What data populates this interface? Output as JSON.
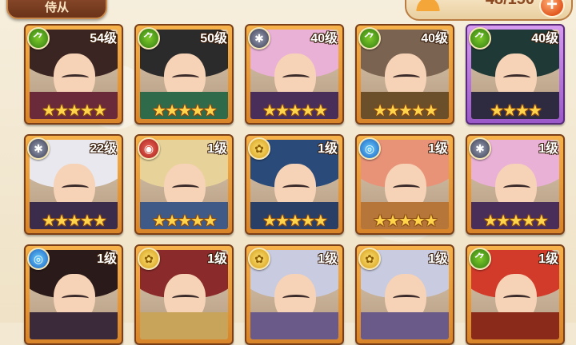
{
  "header": {
    "tab_label": "侍从",
    "capacity_text": "48/150",
    "add_label": "+"
  },
  "cards": [
    {
      "level": "54级",
      "stars": "★★★★★",
      "faction": "green",
      "theme": "orange",
      "hair": "#3a2522",
      "cloth": "#6a2a3a"
    },
    {
      "level": "50级",
      "stars": "★★★★★",
      "faction": "green",
      "theme": "orange",
      "hair": "#2b2b2b",
      "cloth": "#2f6a4b"
    },
    {
      "level": "40级",
      "stars": "★★★★★",
      "faction": "dark",
      "theme": "orange",
      "hair": "#e9b1d6",
      "cloth": "#4a2e5a"
    },
    {
      "level": "40级",
      "stars": "★★★★★",
      "faction": "green",
      "theme": "orange",
      "hair": "#7a6350",
      "cloth": "#6b4f2a"
    },
    {
      "level": "40级",
      "stars": "★★★★",
      "faction": "green",
      "theme": "purple",
      "hair": "#1f3a36",
      "cloth": "#2e2a3f"
    },
    {
      "level": "22级",
      "stars": "★★★★★",
      "faction": "dark",
      "theme": "orange",
      "hair": "#e8e8ee",
      "cloth": "#3a2c4a"
    },
    {
      "level": "1级",
      "stars": "★★★★★",
      "faction": "red",
      "theme": "orange",
      "hair": "#e7d39a",
      "cloth": "#3f5a86"
    },
    {
      "level": "1级",
      "stars": "★★★★★",
      "faction": "gold",
      "theme": "orange",
      "hair": "#2a4a7a",
      "cloth": "#2a3f66"
    },
    {
      "level": "1级",
      "stars": "★★★★★",
      "faction": "blue",
      "theme": "orange",
      "hair": "#e89278",
      "cloth": "#b6763a"
    },
    {
      "level": "1级",
      "stars": "★★★★★",
      "faction": "dark",
      "theme": "orange",
      "hair": "#e9b1d6",
      "cloth": "#4a2e5a"
    },
    {
      "level": "1级",
      "stars": "",
      "faction": "blue",
      "theme": "orange",
      "hair": "#2a1a1a",
      "cloth": "#3a2a3a"
    },
    {
      "level": "1级",
      "stars": "",
      "faction": "gold",
      "theme": "orange",
      "hair": "#8a2a2a",
      "cloth": "#c7a45a"
    },
    {
      "level": "1级",
      "stars": "",
      "faction": "gold",
      "theme": "orange",
      "hair": "#c9cbe0",
      "cloth": "#6a5a8a"
    },
    {
      "level": "1级",
      "stars": "",
      "faction": "gold",
      "theme": "orange",
      "hair": "#c9cbe0",
      "cloth": "#6a5a8a"
    },
    {
      "level": "1级",
      "stars": "",
      "faction": "green",
      "theme": "orange",
      "hair": "#d23a2a",
      "cloth": "#8a2a1a"
    }
  ],
  "faction_icons": {
    "green": "leaf-icon",
    "dark": "web-icon",
    "red": "flame-icon",
    "gold": "flower-icon",
    "blue": "wave-icon"
  }
}
